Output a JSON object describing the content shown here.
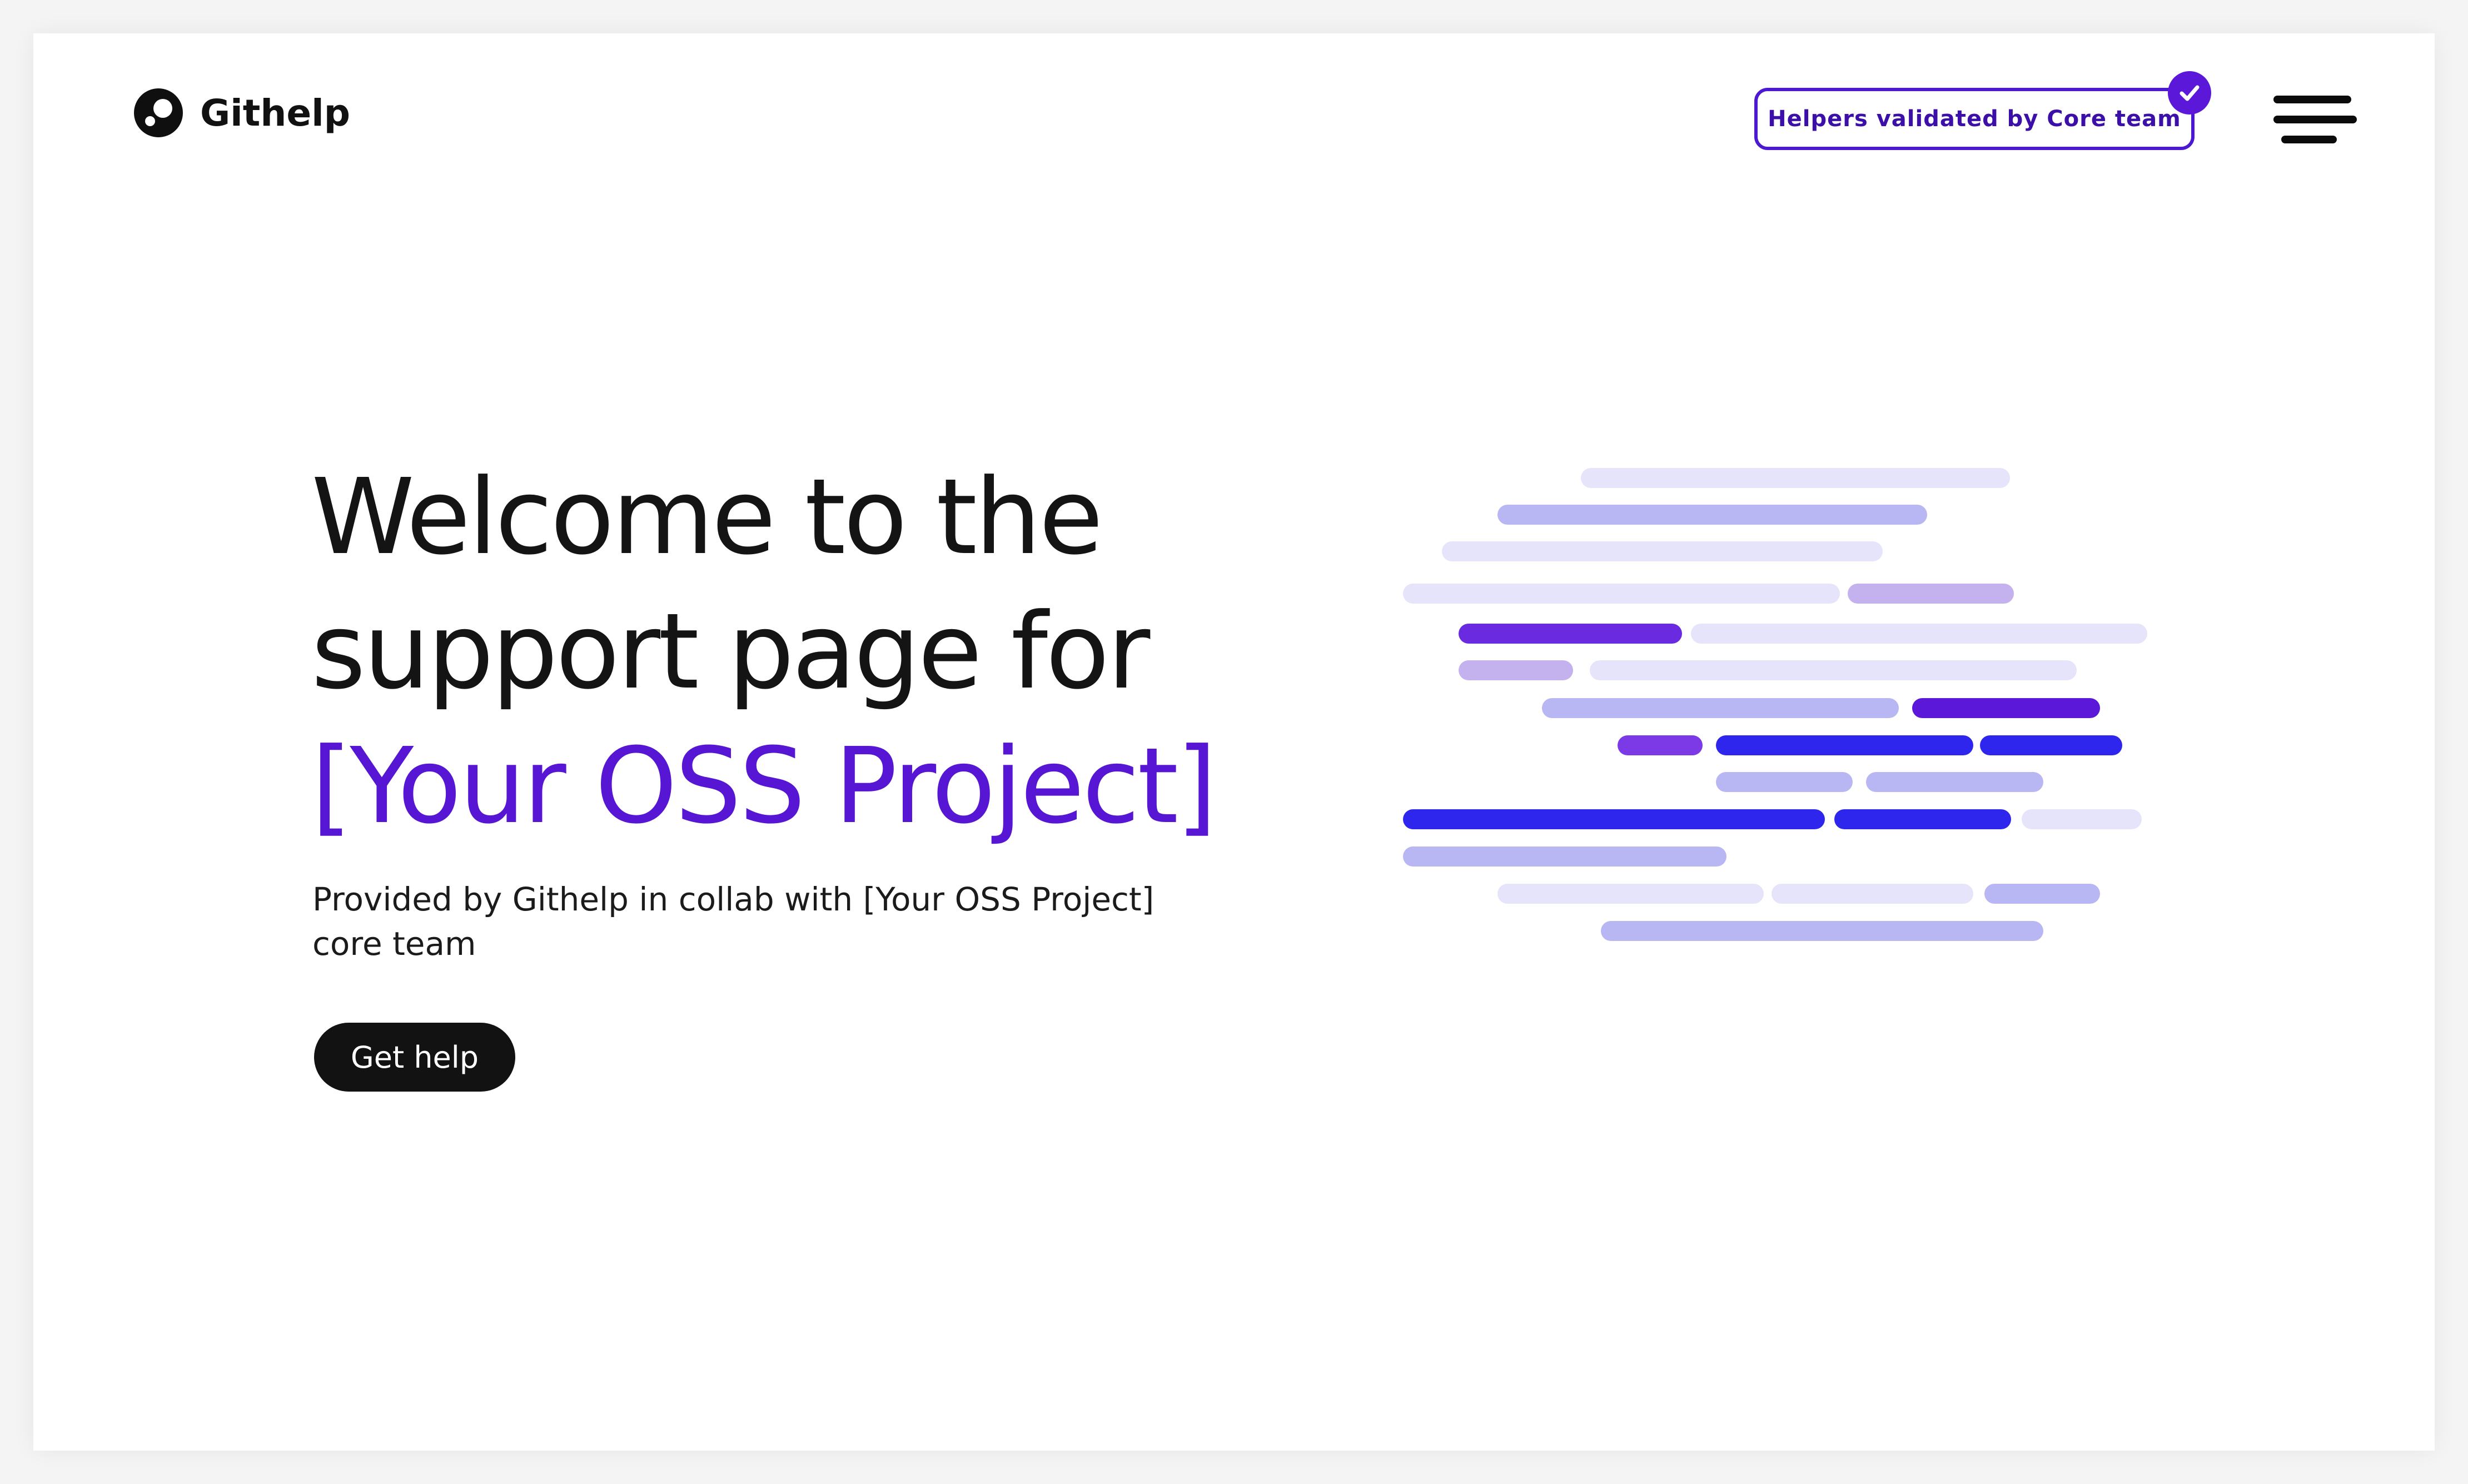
{
  "brand": {
    "name": "Githelp"
  },
  "header": {
    "badge_label": "Helpers validated by Core team",
    "badge_icon": "check-icon",
    "menu_icon": "hamburger-menu-icon"
  },
  "hero": {
    "title_line_1": "Welcome to the",
    "title_line_2": "support page for",
    "title_line_3": "[Your OSS Project]",
    "subtitle": "Provided by Githelp in collab with [Your OSS Project] core team",
    "cta_label": "Get help"
  },
  "colors": {
    "accent": "#5716d3",
    "badge_border": "#4c18d0",
    "text_dark": "#141414",
    "button_bg": "#121212",
    "bar_palette": [
      "#e6e4fb",
      "#b9b6f4",
      "#c3b2ee",
      "#6a2ae0",
      "#5b18d8",
      "#2f26ee",
      "#7c3ae6"
    ]
  }
}
